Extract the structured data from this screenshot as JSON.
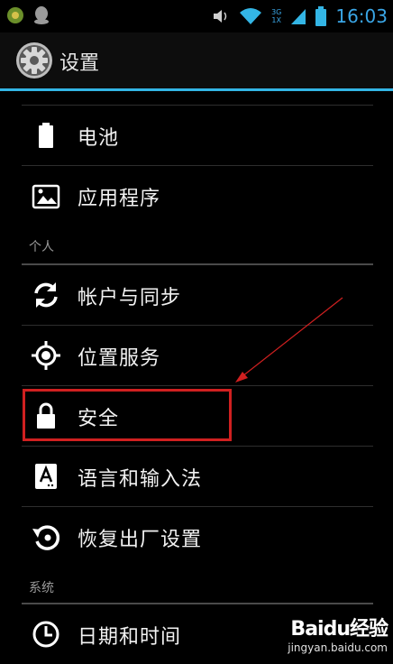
{
  "status_bar": {
    "network_top": "3G",
    "network_bottom": "1X",
    "time": "16:03"
  },
  "action_bar": {
    "title": "设置"
  },
  "settings": {
    "items_top": [
      {
        "label": "电池",
        "icon": "battery-icon"
      },
      {
        "label": "应用程序",
        "icon": "apps-icon"
      }
    ],
    "header_personal": "个人",
    "items_personal": [
      {
        "label": "帐户与同步",
        "icon": "sync-icon"
      },
      {
        "label": "位置服务",
        "icon": "location-icon"
      },
      {
        "label": "安全",
        "icon": "lock-icon"
      },
      {
        "label": "语言和输入法",
        "icon": "keyboard-icon"
      },
      {
        "label": "恢复出厂设置",
        "icon": "restore-icon"
      }
    ],
    "header_system": "系统",
    "items_system": [
      {
        "label": "日期和时间",
        "icon": "clock-icon"
      }
    ]
  },
  "watermark": {
    "logo": "Baidu经验",
    "url": "jingyan.baidu.com"
  },
  "colors": {
    "accent": "#33b5e5",
    "highlight": "#d02020",
    "background": "#000000"
  }
}
